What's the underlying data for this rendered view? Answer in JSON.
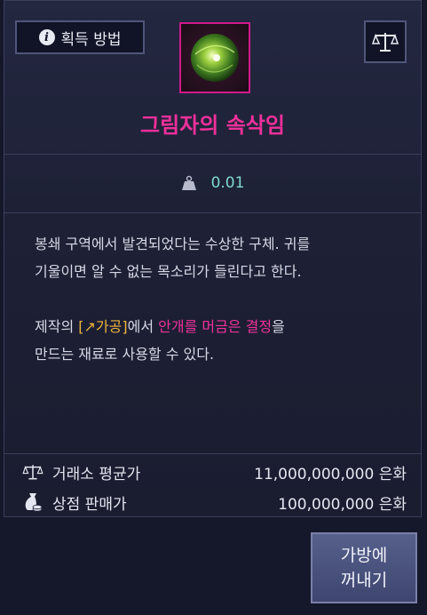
{
  "header": {
    "acquire_label": "획득 방법",
    "item_name": "그림자의 속삭임",
    "item_name_color": "#f0309a",
    "icon_border_color": "#d11a8a"
  },
  "weight": {
    "value": "0.01"
  },
  "description": {
    "line1": "봉쇄 구역에서 발견되었다는 수상한 구체. 귀를",
    "line2": "기울이면 알 수 없는 목소리가 들린다고 한다.",
    "line3_prefix": "제작의 ",
    "line3_link": "[↗가공]",
    "line3_mid": "에서 ",
    "line3_highlight": "안개를 머금은 결정",
    "line3_suffix": "을",
    "line4": "만드는 재료로 사용할 수 있다."
  },
  "prices": {
    "exchange_label": "거래소 평균가",
    "exchange_value": "11,000,000,000 은화",
    "shop_label": "상점 판매가",
    "shop_value": "100,000,000 은화"
  },
  "retrieve_button": {
    "line1": "가방에",
    "line2": "꺼내기"
  },
  "icons": [
    "info-icon",
    "scale-icon",
    "weight-icon",
    "coin-bag-icon",
    "crystal-orb-icon"
  ]
}
